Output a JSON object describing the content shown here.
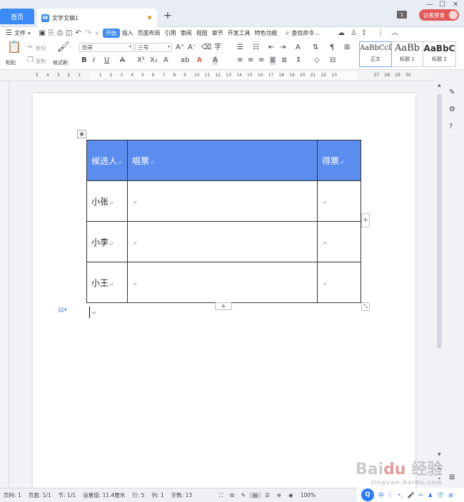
{
  "titlebar": {
    "home_tab": "首页",
    "doc_tab": "文字文稿1",
    "doc_icon": "W",
    "new_tab": "+",
    "window_count": "1",
    "login": "访客登录",
    "minimize": "—",
    "maximize": "☐",
    "close": "✕"
  },
  "menubar": {
    "items": [
      "文件",
      "开始",
      "插入",
      "页面布局",
      "引用",
      "审阅",
      "视图",
      "章节",
      "开发工具",
      "特色功能"
    ],
    "active": "开始",
    "search": "查找命令..."
  },
  "ribbon": {
    "paste": "粘贴",
    "cut": "剪切",
    "copy": "复制",
    "format_painter": "格式刷",
    "font_name": "仿宋",
    "font_size": "三号",
    "styles": [
      {
        "preview": "AaBbCcDd",
        "label": "正文"
      },
      {
        "preview": "AaBb",
        "label": "标题 1"
      },
      {
        "preview": "AaBbC",
        "label": "标题 2"
      }
    ]
  },
  "ruler": {
    "h_marks": [
      "5",
      "4",
      "3",
      "2",
      "1",
      "",
      "1",
      "2",
      "3",
      "4",
      "5",
      "6",
      "7",
      "8",
      "9",
      "10",
      "11",
      "12",
      "13",
      "14",
      "15",
      "16",
      "17",
      "18",
      "19",
      "20",
      "21",
      "22",
      "23",
      "",
      "",
      "",
      "27",
      "28",
      "29",
      "30"
    ]
  },
  "table": {
    "headers": [
      "候选人",
      "唱票",
      "得票"
    ],
    "rows": [
      [
        "小张",
        "",
        ""
      ],
      [
        "小李",
        "",
        ""
      ],
      [
        "小王",
        "",
        ""
      ]
    ],
    "para_mark": "↵",
    "header_color": "#5b8def"
  },
  "statusbar": {
    "page_no": "页码: 1",
    "pages": "页面: 1/1",
    "section": "节: 1/1",
    "setting": "设置值: 11.4厘米",
    "row": "行: 5",
    "col": "列: 1",
    "words": "字数: 13",
    "zoom": "100%"
  },
  "ime": {
    "logo": "Q",
    "lang": "中"
  },
  "watermark": {
    "text": "Bai du 经验",
    "sub": "jingyan.baidu.com"
  }
}
